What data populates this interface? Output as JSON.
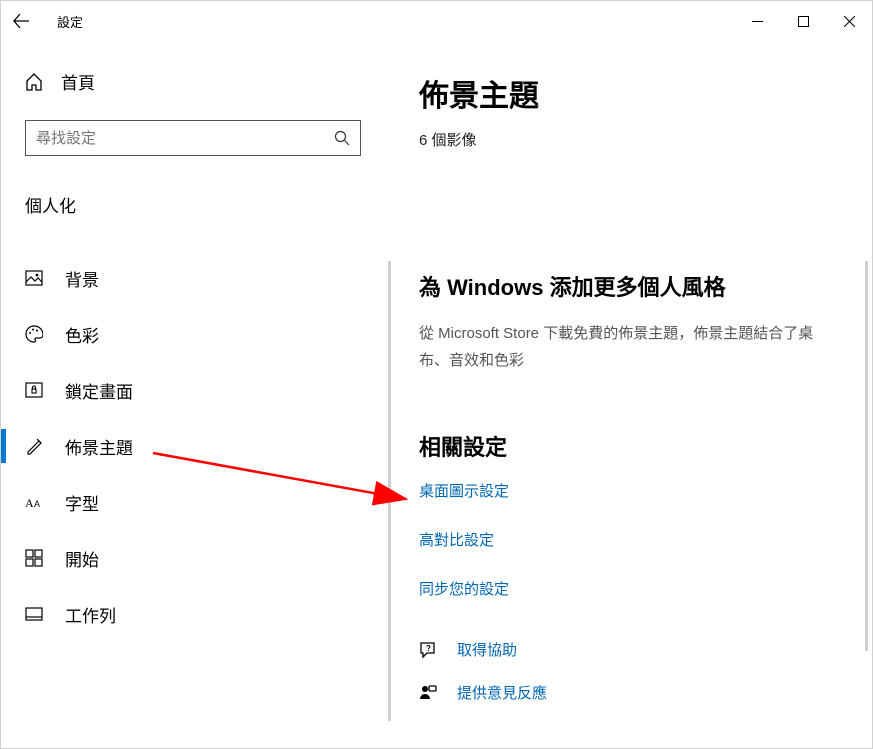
{
  "window": {
    "title": "設定"
  },
  "sidebar": {
    "home": "首頁",
    "search_placeholder": "尋找設定",
    "category": "個人化",
    "items": [
      {
        "label": "背景"
      },
      {
        "label": "色彩"
      },
      {
        "label": "鎖定畫面"
      },
      {
        "label": "佈景主題"
      },
      {
        "label": "字型"
      },
      {
        "label": "開始"
      },
      {
        "label": "工作列"
      }
    ]
  },
  "main": {
    "title": "佈景主題",
    "image_count": "6 個影像",
    "more_heading": "為 Windows 添加更多個人風格",
    "more_body": "從 Microsoft Store 下載免費的佈景主題，佈景主題結合了桌布、音效和色彩",
    "related_heading": "相關設定",
    "links": {
      "desktop_icon": "桌面圖示設定",
      "high_contrast": "高對比設定",
      "sync": "同步您的設定"
    },
    "help": "取得協助",
    "feedback": "提供意見反應"
  }
}
